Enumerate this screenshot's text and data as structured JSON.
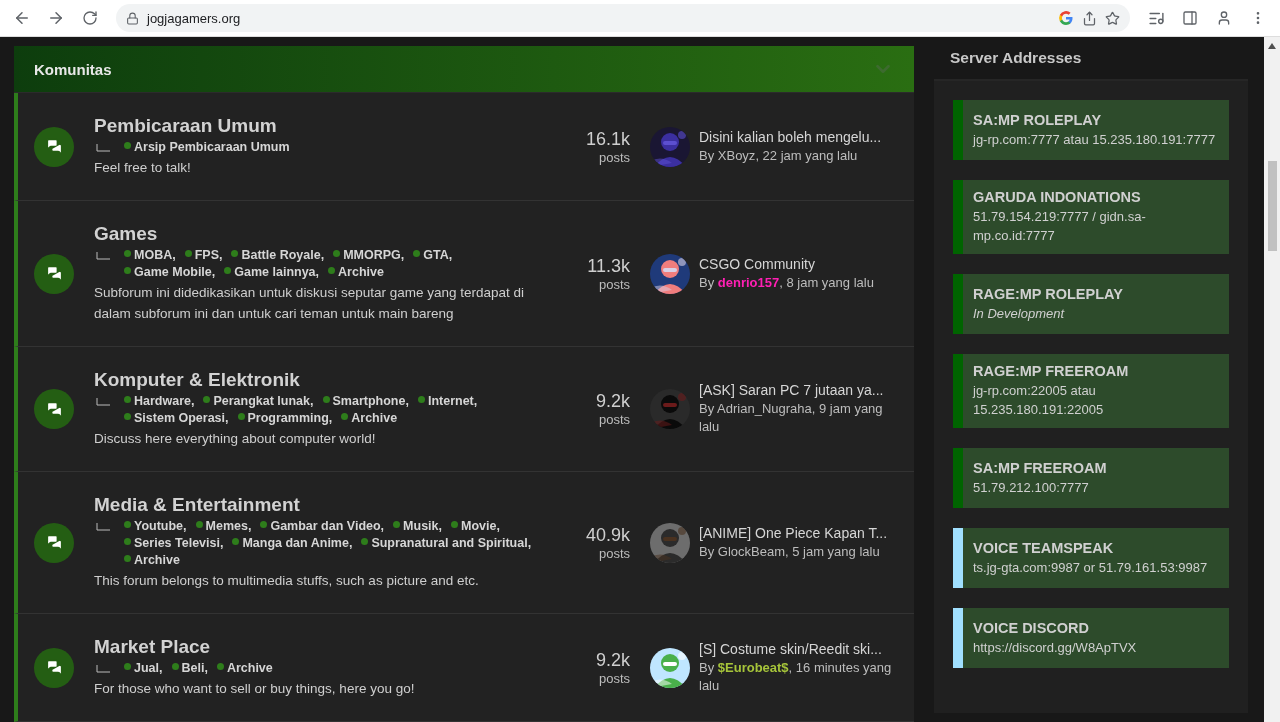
{
  "browser": {
    "url": "jogjagamers.org"
  },
  "forum": {
    "title": "Komunitas",
    "expanded": true,
    "rows": [
      {
        "title": "Pembicaraan Umum",
        "subforums": [
          "Arsip Pembicaraan Umum"
        ],
        "description": "Feel free to talk!",
        "count": "16.1k",
        "count_label": "posts",
        "last_post": {
          "title": "Disini kalian boleh mengelu...",
          "prefix": "By",
          "author": {
            "name": "XBoyz"
          },
          "rest": ", 22 jam yang lalu"
        },
        "avatar": {
          "kind": "picture"
        }
      },
      {
        "title": "Games",
        "subforums": [
          "MOBA,",
          "FPS,",
          "Battle Royale,",
          "MMORPG,",
          "GTA,",
          "Game Mobile,",
          "Game lainnya,",
          "Archive"
        ],
        "description": "Subforum ini didedikasikan untuk diskusi seputar game yang terdapat di dalam subforum ini dan untuk cari teman untuk main bareng",
        "count": "11.3k",
        "count_label": "posts",
        "last_post": {
          "title": "CSGO Community",
          "prefix": "By",
          "author": {
            "name": "denrio157",
            "color": "#ff1fb4"
          },
          "rest": ", 8 jam yang lalu"
        },
        "avatar": {
          "kind": "picture"
        }
      },
      {
        "title": "Komputer & Elektronik",
        "subforums": [
          "Hardware,",
          "Perangkat lunak,",
          "Smartphone,",
          "Internet,",
          "Sistem Operasi,",
          "Programming,",
          "Archive"
        ],
        "description": "Discuss here everything about computer world!",
        "count": "9.2k",
        "count_label": "posts",
        "last_post": {
          "title": "[ASK] Saran PC 7 jutaan ya...",
          "prefix": "By",
          "author": {
            "name": "Adrian_Nugraha"
          },
          "rest": ", 9 jam yang lalu"
        },
        "avatar": {
          "kind": "picture"
        }
      },
      {
        "title": "Media & Entertainment",
        "subforums": [
          "Youtube,",
          "Memes,",
          "Gambar dan Video,",
          "Musik,",
          "Movie,",
          "Series Televisi,",
          "Manga dan Anime,",
          "Supranatural and Spiritual,",
          "Archive"
        ],
        "description": "This forum belongs to multimedia stuffs, such as picture and etc.",
        "count": "40.9k",
        "count_label": "posts",
        "last_post": {
          "title": "[ANIME] One Piece Kapan T...",
          "prefix": "By",
          "author": {
            "name": "GlockBeam"
          },
          "rest": ", 5 jam yang lalu"
        },
        "avatar": {
          "kind": "picture"
        }
      },
      {
        "title": "Market Place",
        "subforums": [
          "Jual,",
          "Beli,",
          "Archive"
        ],
        "description": "For those who want to sell or buy things, here you go!",
        "count": "9.2k",
        "count_label": "posts",
        "last_post": {
          "title": "[S] Costume skin/Reedit ski...",
          "prefix": "By",
          "author": {
            "name": "$Eurobeat$",
            "color": "#a6c43a"
          },
          "rest": ", 16 minutes yang lalu"
        },
        "avatar": {
          "kind": "picture"
        }
      }
    ]
  },
  "sidebar": {
    "title": "Server Addresses",
    "servers": [
      {
        "name": "SA:MP ROLEPLAY",
        "detail": "jg-rp.com:7777 atau 15.235.180.191:7777",
        "kind": "address",
        "color": "#006400"
      },
      {
        "name": "GARUDA INDONATIONS",
        "detail": "51.79.154.219:7777 / gidn.sa-mp.co.id:7777",
        "kind": "address",
        "color": "#006400"
      },
      {
        "name": "RAGE:MP ROLEPLAY",
        "detail": "In Development",
        "kind": "note",
        "color": "#006400"
      },
      {
        "name": "RAGE:MP FREEROAM",
        "detail": "jg-rp.com:22005 atau 15.235.180.191:22005",
        "kind": "address",
        "color": "#006400"
      },
      {
        "name": "SA:MP FREEROAM",
        "detail": "51.79.212.100:7777",
        "kind": "address",
        "color": "#006400"
      },
      {
        "name": "VOICE TEAMSPEAK",
        "detail": "ts.jg-gta.com:9987 or 51.79.161.53:9987",
        "kind": "address",
        "color": "#a0e0ff"
      },
      {
        "name": "VOICE DISCORD",
        "detail": "https://discord.gg/W8ApTVX",
        "kind": "address",
        "color": "#a0e0ff"
      }
    ]
  }
}
